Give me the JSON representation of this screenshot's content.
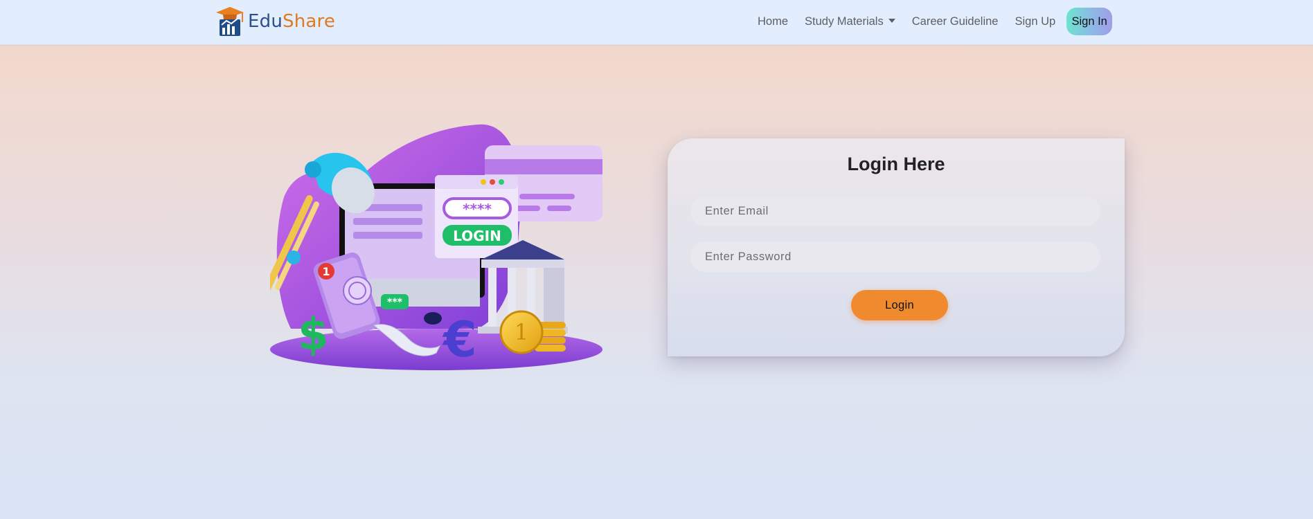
{
  "brand": {
    "name_part1": "Edu",
    "name_part2": "Share",
    "icon": "graduation-cap-chart-logo"
  },
  "nav": {
    "home": "Home",
    "study_materials": "Study Materials",
    "career": "Career Guideline",
    "signup": "Sign Up",
    "signin": "Sign In"
  },
  "illustration": {
    "login_label": "LOGIN",
    "password_mask": "****",
    "notification_count": "1",
    "otp_mask": "***"
  },
  "login": {
    "title": "Login Here",
    "email_placeholder": "Enter Email",
    "password_placeholder": "Enter Password",
    "button_label": "Login"
  },
  "colors": {
    "accent_orange": "#f08a2e",
    "brand_blue": "#2b4f8f",
    "purple": "#a45ce0"
  }
}
